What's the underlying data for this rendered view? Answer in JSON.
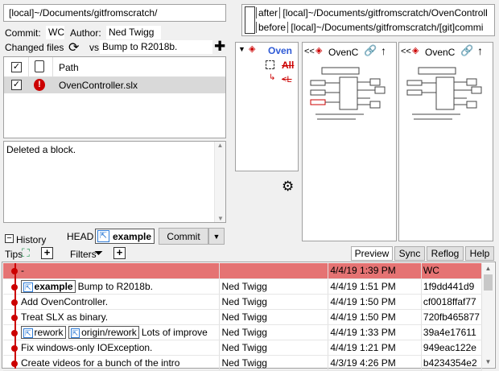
{
  "repo_path": "[local]~/Documents/gitfromscratch/",
  "commit_label": "Commit:",
  "commit_value": "WC",
  "author_label": "Author:",
  "author_value": "Ned Twigg",
  "changed_files_label": "Changed files",
  "vs_label": "vs",
  "vs_value": "Bump to R2018b.",
  "file_table": {
    "path_header": "Path",
    "rows": [
      {
        "checked": "✓",
        "name": "OvenController.slx"
      }
    ]
  },
  "message": "Deleted a block.",
  "history_label": "History",
  "head_label": "HEAD",
  "head_branch": "example",
  "commit_button": "Commit",
  "tips_label": "Tips",
  "filters_label": "Filters",
  "after_label": "after",
  "after_path": "[local]~/Documents/gitfromscratch/OvenControll",
  "before_label": "before",
  "before_path": "[local]~/Documents/gitfromscratch/[git]commi",
  "tree": {
    "root": "Oven",
    "item1": "All",
    "item2": "<L"
  },
  "panel_title": "OvenC",
  "tabs": {
    "preview": "Preview",
    "sync": "Sync",
    "reflog": "Reflog",
    "help": "Help"
  },
  "history": [
    {
      "branches": [],
      "message": "-",
      "author": "",
      "date": "4/4/19 1:39 PM",
      "hash": "WC",
      "selected": true
    },
    {
      "branches": [
        "example"
      ],
      "message": "Bump to R2018b.",
      "author": "Ned Twigg",
      "date": "4/4/19 1:51 PM",
      "hash": "1f9dd441d9"
    },
    {
      "branches": [],
      "message": "Add OvenController.",
      "author": "Ned Twigg",
      "date": "4/4/19 1:50 PM",
      "hash": "cf0018ffaf77"
    },
    {
      "branches": [],
      "message": "Treat SLX as binary.",
      "author": "Ned Twigg",
      "date": "4/4/19 1:50 PM",
      "hash": "720fb465877"
    },
    {
      "branches": [
        "rework",
        "origin/rework"
      ],
      "message": "Lots of improve",
      "author": "Ned Twigg",
      "date": "4/4/19 1:33 PM",
      "hash": "39a4e17611"
    },
    {
      "branches": [],
      "message": "Fix windows-only IOException.",
      "author": "Ned Twigg",
      "date": "4/4/19 1:21 PM",
      "hash": "949eac122e"
    },
    {
      "branches": [],
      "message": "Create videos for a bunch of the intro",
      "author": "Ned Twigg",
      "date": "4/3/19 4:26 PM",
      "hash": "b4234354e2"
    }
  ],
  "colors": {
    "selected_row": "#e57373",
    "graph_line": "#cc0000"
  }
}
